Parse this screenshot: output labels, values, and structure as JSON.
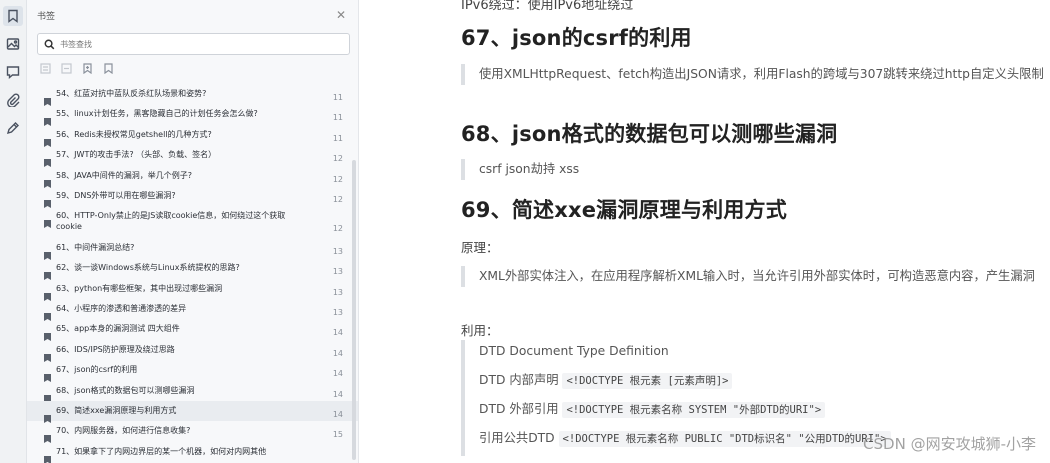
{
  "panel": {
    "title": "书签",
    "search_placeholder": "书签查找",
    "items": [
      {
        "label": "54、红蓝对抗中蓝队反杀红队场景和姿势?",
        "page": "11"
      },
      {
        "label": "55、linux计划任务，黑客隐藏自己的计划任务会怎么做?",
        "page": "11"
      },
      {
        "label": "56、Redis未授权常见getshell的几种方式?",
        "page": "11"
      },
      {
        "label": "57、JWT的攻击手法? （头部、负载、签名）",
        "page": "12"
      },
      {
        "label": "58、JAVA中间件的漏洞，举几个例子?",
        "page": "12"
      },
      {
        "label": "59、DNS外带可以用在哪些漏洞?",
        "page": "12"
      },
      {
        "label": "60、HTTP-Only禁止的是JS读取cookie信息，如何绕过这个获取cookie",
        "page": "12"
      },
      {
        "label": "61、中间件漏洞总结?",
        "page": "13"
      },
      {
        "label": "62、谈一谈Windows系统与Linux系统提权的思路?",
        "page": "13"
      },
      {
        "label": "63、python有哪些框架，其中出现过哪些漏洞",
        "page": "13"
      },
      {
        "label": "64、小程序的渗透和普通渗透的差异",
        "page": "13"
      },
      {
        "label": "65、app本身的漏洞测试 四大组件",
        "page": "14"
      },
      {
        "label": "66、IDS/IPS防护原理及绕过思路",
        "page": "14"
      },
      {
        "label": "67、json的csrf的利用",
        "page": "14"
      },
      {
        "label": "68、json格式的数据包可以测哪些漏洞",
        "page": "14"
      },
      {
        "label": "69、简述xxe漏洞原理与利用方式",
        "page": "14"
      },
      {
        "label": "70、内网服务器，如何进行信息收集?",
        "page": "15"
      },
      {
        "label": "71、如果拿下了内网边界层的某一个机器，如何对内网其他",
        "page": ""
      }
    ]
  },
  "doc": {
    "top_cut": "IPv6绕过：使用IPv6地址绕过",
    "h67": "67、json的csrf的利用",
    "q67": "使用XMLHttpRequest、fetch构造出JSON请求，利用Flash的跨域与307跳转来绕过http自定义头限制",
    "h68": "68、json格式的数据包可以测哪些漏洞",
    "q68": "csrf json劫持 xss",
    "h69": "69、简述xxe漏洞原理与利用方式",
    "principle_label": "原理：",
    "q69": "XML外部实体注入，在应用程序解析XML输入时，当允许引用外部实体时，可构造恶意内容，产生漏洞",
    "usage_label": "利用：",
    "code": {
      "l1_text": "DTD Document Type Definition",
      "l2_text": "DTD 内部声明 ",
      "l2_code": "<!DOCTYPE 根元素 [元素声明]>",
      "l3_text": "DTD 外部引用 ",
      "l3_code": "<!DOCTYPE 根元素名称 SYSTEM \"外部DTD的URI\">",
      "l4_text": "引用公共DTD ",
      "l4_code": "<!DOCTYPE 根元素名称 PUBLIC \"DTD标识名\" \"公用DTD的URI\">"
    },
    "watermark": "CSDN @网安攻城狮-小李"
  }
}
